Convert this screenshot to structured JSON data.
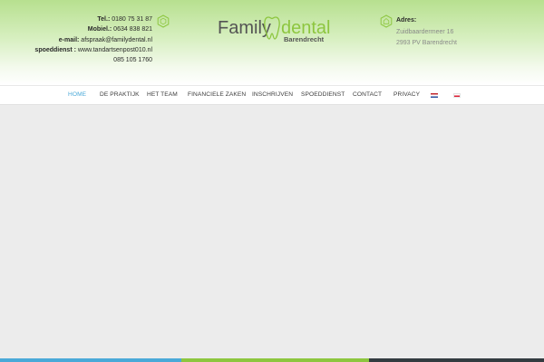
{
  "colors": {
    "accent_blue": "#4aa9d8",
    "brand_green": "#8dc63f",
    "dark_gray": "#333b40",
    "content_bg": "#ececec"
  },
  "contact": {
    "tel_label": "Tel.:",
    "tel_value": "0180 75 31 87",
    "mobile_label": "Mobiel.:",
    "mobile_value": "0634 838 821",
    "email_label": "e-mail:",
    "email_value": "afspraak@familydental.nl",
    "emergency_label": "spoeddienst :",
    "emergency_url": "www.tandartsenpost010.nl",
    "emergency_phone": "085 105 1760",
    "icon": "hexagon-phone-icon"
  },
  "logo": {
    "word_family": "Family",
    "word_dental": "dental",
    "subtitle": "Barendrecht"
  },
  "address": {
    "title": "Adres:",
    "street": "Zuidbaardermeer 16",
    "city": "2993 PV Barendrecht",
    "icon": "hexagon-home-icon"
  },
  "nav": {
    "items": [
      {
        "label": "HOME",
        "active": true
      },
      {
        "label": "DE PRAKTIJK",
        "active": false
      },
      {
        "label": "HET TEAM",
        "active": false
      },
      {
        "label": "FINANCIELE ZAKEN",
        "active": false
      },
      {
        "label": "INSCHRIJVEN",
        "active": false
      },
      {
        "label": "SPOEDDIENST",
        "active": false
      },
      {
        "label": "CONTACT",
        "active": false
      },
      {
        "label": "PRIVACY",
        "active": false
      }
    ],
    "flags": [
      "dutch-flag-icon",
      "polish-flag-icon"
    ]
  }
}
